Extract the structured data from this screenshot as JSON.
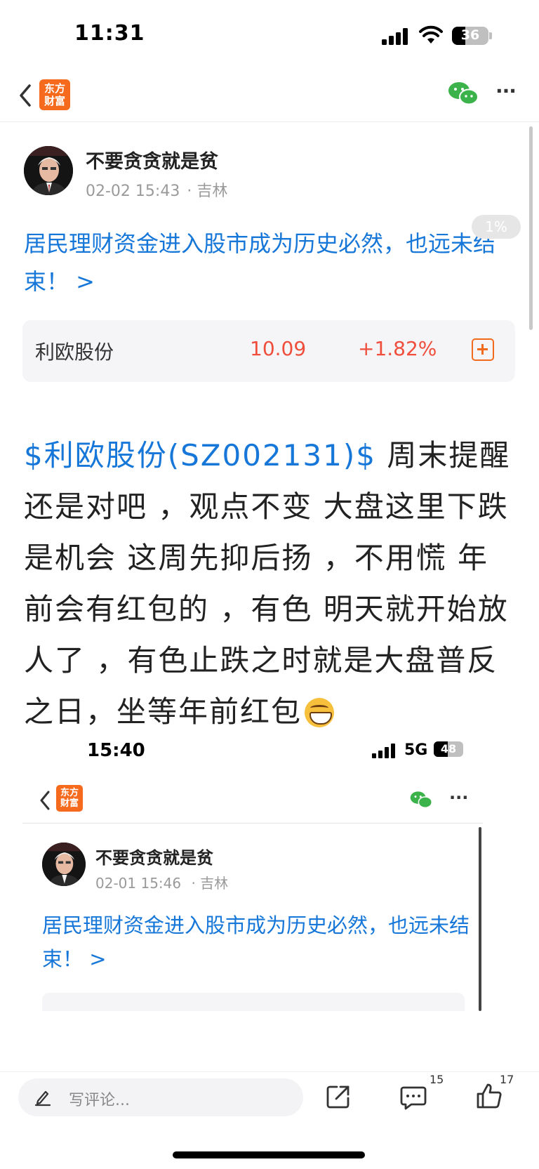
{
  "status_bar": {
    "time": "11:31",
    "battery": "36"
  },
  "nav": {
    "logo_text": "东方财富"
  },
  "post": {
    "author": "不要贪贪就是贫",
    "timestamp": "02-02 15:43",
    "location": "· 吉林",
    "read_progress": "1%",
    "topic": "居民理财资金进入股市成为历史必然，也远未结束！ >",
    "stock": {
      "name": "利欧股份",
      "price": "10.09",
      "change": "+1.82%"
    },
    "body_tag": "$利欧股份(SZ002131)$",
    "body_text": " 周末提醒还是对吧 ，观点不变 大盘这里下跌是机会 这周先抑后扬 ，不用慌 年前会有红包的 ，有色 明天就开始放人了 ，有色止跌之时就是大盘普反之日，坐等年前红包"
  },
  "embedded_screenshot": {
    "time": "15:40",
    "network": "5G",
    "battery": "48",
    "logo_text": "东方财富",
    "author": "不要贪贪就是贫",
    "timestamp": "02-01 15:46",
    "location": "· 吉林",
    "topic": "居民理财资金进入股市成为历史必然，也远未结束！ >"
  },
  "bottom_bar": {
    "comment_placeholder": "写评论...",
    "comments_count": "15",
    "likes_count": "17"
  },
  "colors": {
    "accent_blue": "#1677d9",
    "price_red": "#ef4e3c",
    "brand_orange": "#f56a1d",
    "wechat_green": "#3cb34a"
  }
}
